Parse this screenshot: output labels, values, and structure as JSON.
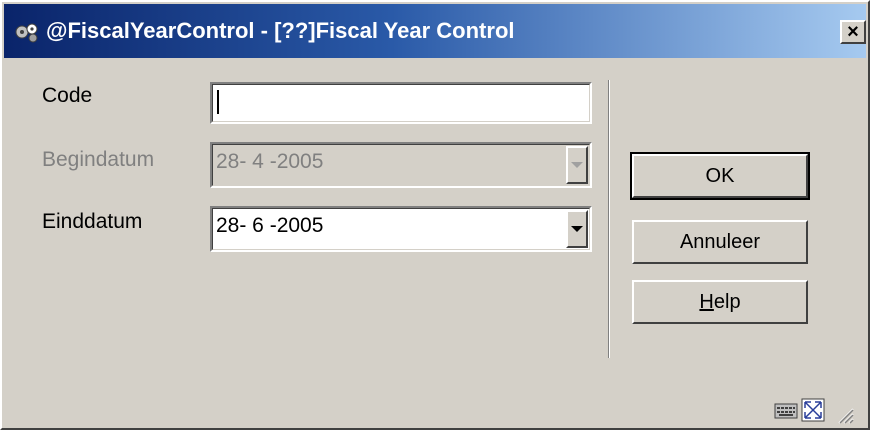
{
  "window": {
    "title": "@FiscalYearControl - [??]Fiscal Year Control",
    "close_label": "×"
  },
  "form": {
    "code": {
      "label": "Code",
      "value": ""
    },
    "begindatum": {
      "label": "Begindatum",
      "value": "28- 4 -2005",
      "enabled": false
    },
    "einddatum": {
      "label": "Einddatum",
      "value": "28- 6 -2005",
      "enabled": true
    }
  },
  "buttons": {
    "ok": "OK",
    "cancel": "Annuleer",
    "help_mnemonic": "H",
    "help_rest": "elp"
  },
  "icons": {
    "app": "gear-cluster-icon",
    "status": [
      "keyboard-icon",
      "resize-icon",
      "size-grip-icon"
    ]
  }
}
